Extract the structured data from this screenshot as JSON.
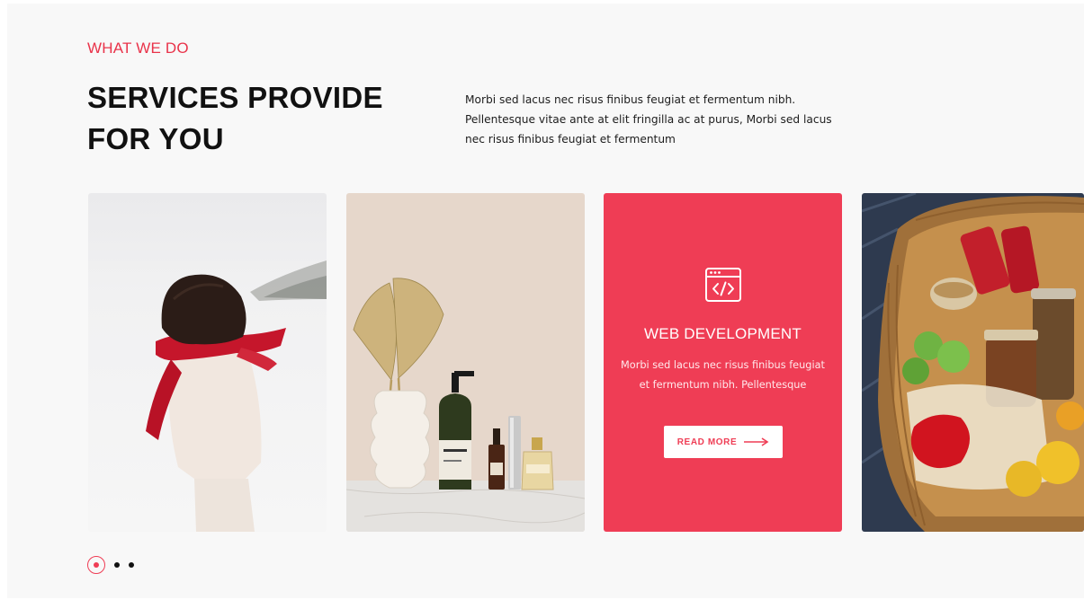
{
  "section": {
    "eyebrow": "WHAT WE DO",
    "title_line1": "SERVICES PROVIDE",
    "title_line2": "FOR YOU",
    "intro": "Morbi sed lacus nec risus finibus feugiat et fermentum nibh. Pellentesque vitae ante at elit fringilla ac at purus, Morbi sed lacus nec risus finibus feugiat et fermentum"
  },
  "cards": [
    {
      "type": "image",
      "subject": "woman-in-red-scarf-snow"
    },
    {
      "type": "image",
      "subject": "vase-and-cosmetic-bottles"
    },
    {
      "type": "service",
      "icon": "code-window-icon",
      "title": "WEB DEVELOPMENT",
      "description": "Morbi sed lacus nec risus finibus feugiat et fermentum nibh. Pellentesque",
      "button_label": "READ MORE"
    },
    {
      "type": "image",
      "subject": "basket-of-groceries"
    }
  ],
  "pagination": {
    "total": 3,
    "active": 1
  },
  "colors": {
    "accent": "#ef3d55",
    "heading": "#111111",
    "background": "#f8f8f8"
  }
}
